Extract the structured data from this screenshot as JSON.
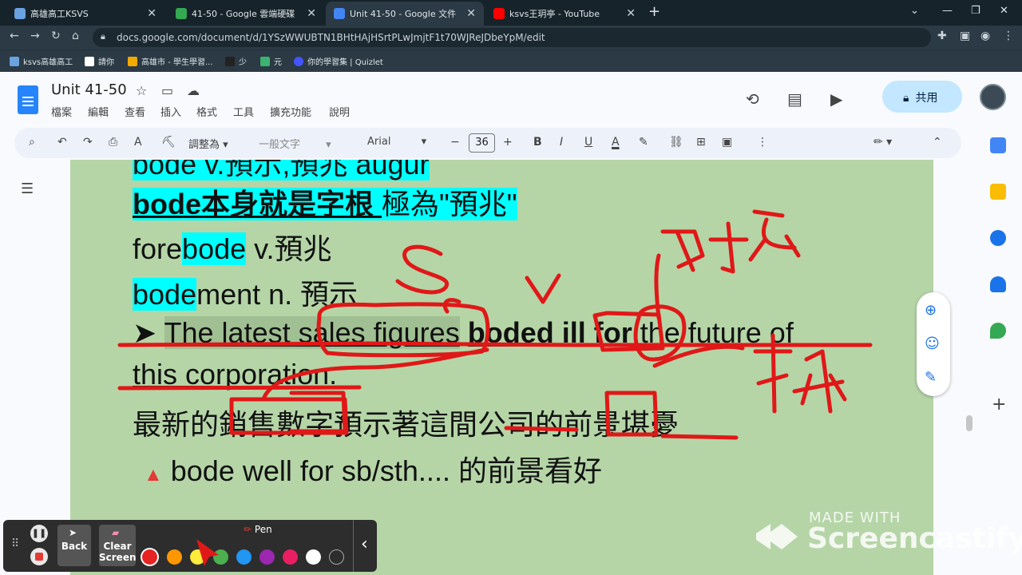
{
  "tabs": [
    {
      "title": "高雄高工KSVS",
      "color": "#6aa1e0"
    },
    {
      "title": "41-50 - Google 雲端硬碟",
      "color": "#34a853"
    },
    {
      "title": "Unit 41-50 - Google 文件",
      "color": "#4285f4"
    },
    {
      "title": "ksvs王玥亭 - YouTube",
      "color": "#ff0000"
    }
  ],
  "url": "docs.google.com/document/d/1YSzWWUBTN1BHtHAjHSrtPLwJmjtF1t70WJReJDbeYpM/edit",
  "bookmarks": [
    "ksvs高雄高工",
    "請你",
    "高雄市 - 學生學習...",
    "少",
    "元",
    "你的學習集 | Quizlet"
  ],
  "doc": {
    "title": "Unit 41-50",
    "menus": [
      "檔案",
      "編輯",
      "查看",
      "插入",
      "格式",
      "工具",
      "擴充功能",
      "說明"
    ],
    "share": "共用"
  },
  "toolbar": {
    "zoom": "調整為",
    "style": "一般文字",
    "font": "Arial",
    "size": "36"
  },
  "content": {
    "line0": "bode   v.預示,預兆  augur",
    "l1a": "bode本身就是字根 ",
    "l1b": "極為\"預兆\"",
    "l2a": "fore",
    "l2b": "bode",
    "l2c": "    v.預兆",
    "l3a": "bode",
    "l3b": "ment   n. 預示",
    "l4arrow": "➤ ",
    "l4a": "The latest sales figures",
    "l4b": " ",
    "l4c": "boded ill for",
    "l4d": " the future of",
    "l5": "this corporation.",
    "l6": "最新的銷售數字預示著這間公司的前景堪憂",
    "l7a": "▲",
    "l7b": " bode well for sb/sth.... 的前景看好"
  },
  "penbar": {
    "back": "Back",
    "clear1": "Clear",
    "clear2": "Screen",
    "label": "Pen",
    "colors": [
      "#e62222",
      "#ff9800",
      "#ffeb3b",
      "#4caf50",
      "#2196f3",
      "#9c27b0",
      "#e91e63",
      "#ffffff",
      "#2d2d2d"
    ]
  },
  "watermark": {
    "line1": "MADE WITH",
    "line2": "Screencastify"
  },
  "annotations": {
    "a1": "S",
    "a2": "v."
  }
}
